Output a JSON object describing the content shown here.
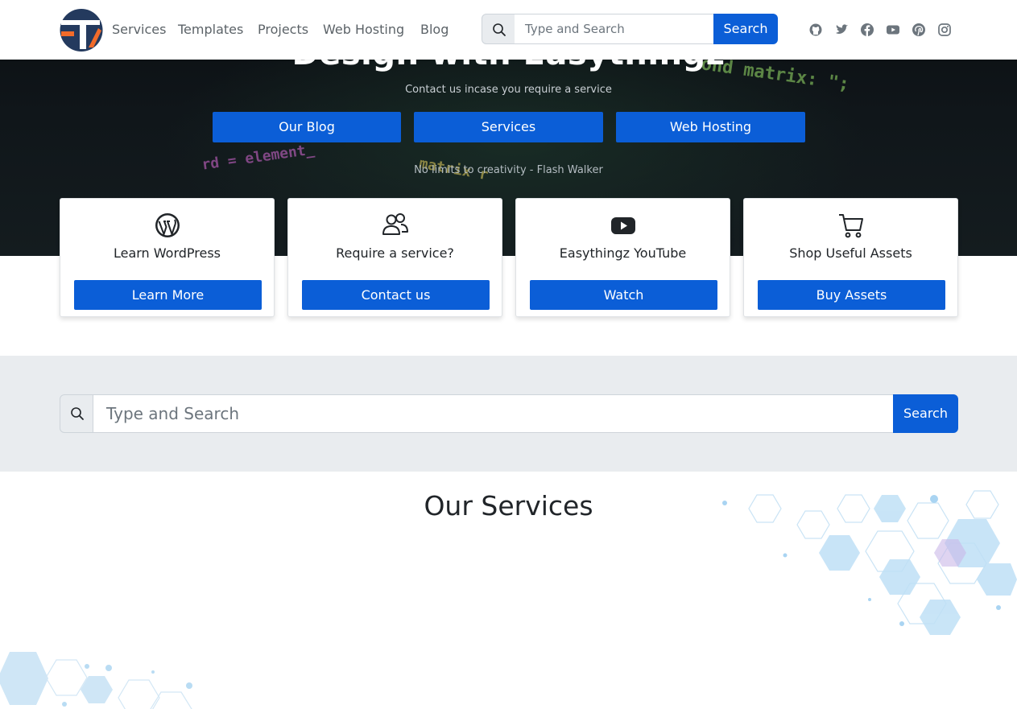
{
  "nav": {
    "links": [
      "Services",
      "Templates",
      "Projects",
      "Web Hosting",
      "Blog"
    ],
    "search_placeholder": "Type and Search",
    "search_button": "Search",
    "social_icons": [
      "github-icon",
      "twitter-icon",
      "facebook-icon",
      "youtube-icon",
      "pinterest-icon",
      "instagram-icon"
    ]
  },
  "hero": {
    "title": "Design with Easythingz",
    "subtitle": "Contact us incase you require a service",
    "buttons": [
      "Our Blog",
      "Services",
      "Web Hosting"
    ],
    "quote": "No limits to creativity - Flash Walker"
  },
  "cards": [
    {
      "icon": "wordpress-icon",
      "title": "Learn WordPress",
      "button": "Learn More"
    },
    {
      "icon": "users-icon",
      "title": "Require a service?",
      "button": "Contact us"
    },
    {
      "icon": "youtube-icon",
      "title": "Easythingz YouTube",
      "button": "Watch"
    },
    {
      "icon": "cart-icon",
      "title": "Shop Useful Assets",
      "button": "Buy Assets"
    }
  ],
  "search_band": {
    "placeholder": "Type and Search",
    "button": "Search"
  },
  "services": {
    "title": "Our Services"
  },
  "colors": {
    "primary": "#0b5ed7",
    "band": "#e9ecef",
    "hero_dark": "#0b0f12",
    "logo_navy": "#243a5e",
    "logo_orange": "#f26b2a"
  }
}
